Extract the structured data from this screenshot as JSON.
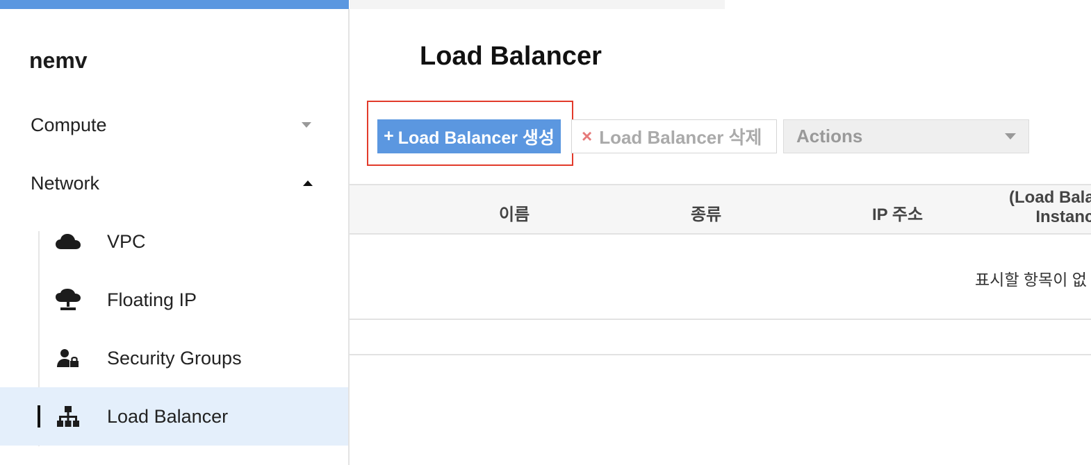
{
  "sidebar": {
    "project_name": "nemv",
    "groups": [
      {
        "label": "Compute",
        "expanded": false
      },
      {
        "label": "Network",
        "expanded": true
      }
    ],
    "network_items": [
      {
        "label": "VPC",
        "icon": "cloud-icon"
      },
      {
        "label": "Floating IP",
        "icon": "network-cloud-icon"
      },
      {
        "label": "Security Groups",
        "icon": "user-lock-icon"
      },
      {
        "label": "Load Balancer",
        "icon": "sitemap-icon",
        "active": true
      }
    ]
  },
  "main": {
    "title": "Load Balancer",
    "toolbar": {
      "create_label": "Load Balancer 생성",
      "create_prefix": "+",
      "delete_label": "Load Balancer 삭제",
      "delete_prefix": "×",
      "actions_label": "Actions"
    },
    "table": {
      "columns": [
        "이름",
        "종류",
        "IP 주소",
        "(Load Bala",
        "Instanc"
      ],
      "empty_message": "표시할 항목이 없"
    }
  },
  "colors": {
    "accent": "#5b97e0",
    "highlight_border": "#e23a2a",
    "active_bg": "#e4effb"
  }
}
